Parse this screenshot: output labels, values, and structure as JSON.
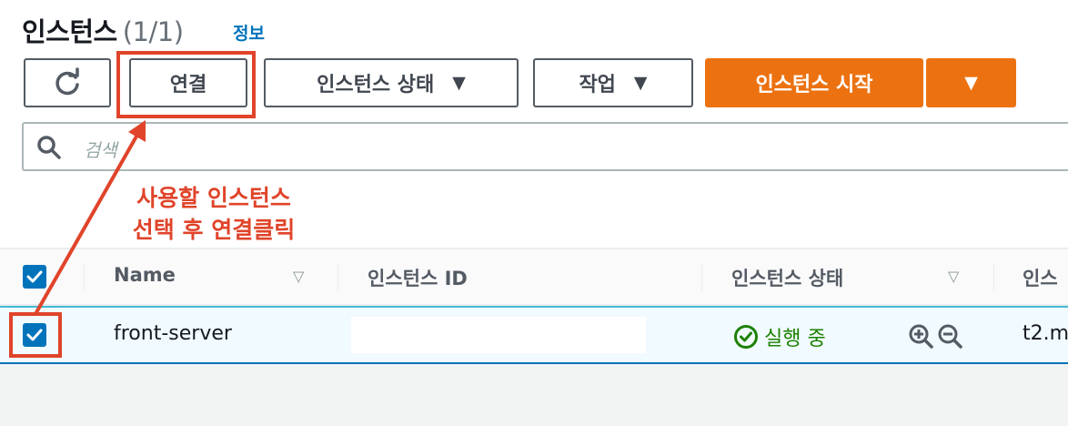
{
  "header": {
    "title": "인스턴스",
    "count": "(1/1)",
    "info_link": "정보"
  },
  "toolbar": {
    "refresh_icon": "refresh-icon",
    "connect_label": "연결",
    "instance_state_label": "인스턴스 상태",
    "actions_label": "작업",
    "launch_label": "인스턴스 시작",
    "caret_icon": "caret-down-icon"
  },
  "search": {
    "placeholder": "검색",
    "icon": "search-icon"
  },
  "annotation": {
    "line1": "사용할 인스턴스",
    "line2": "선택 후 연결클릭",
    "color": "#e0442a"
  },
  "table": {
    "columns": [
      "Name",
      "인스턴스 ID",
      "인스턴스 상태",
      "인스"
    ],
    "rows": [
      {
        "name": "front-server",
        "instance_id": "",
        "state": "실행 중",
        "type": "t2.m",
        "selected": true
      }
    ]
  },
  "colors": {
    "accent": "#ec7211",
    "link": "#0073bb",
    "running": "#1d8102"
  }
}
